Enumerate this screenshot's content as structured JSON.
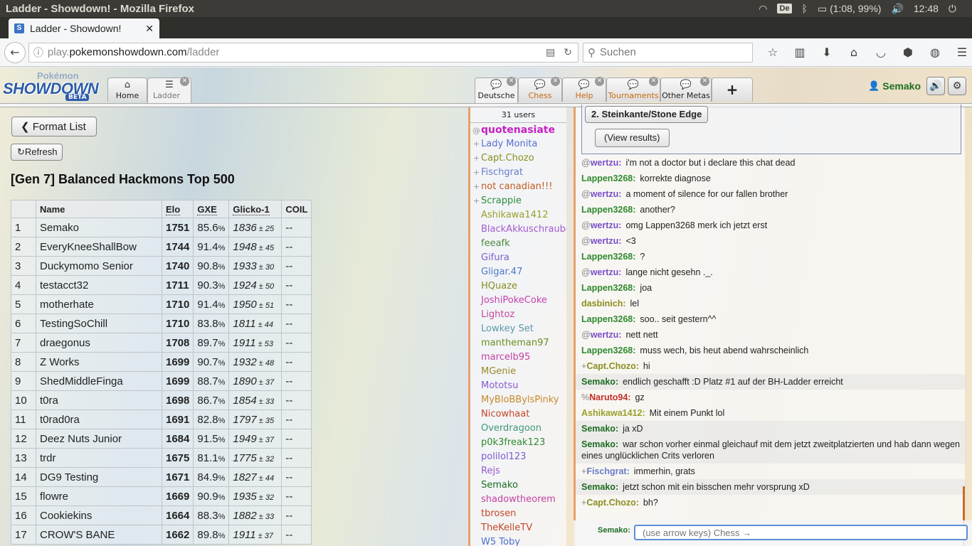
{
  "os": {
    "window_title": "Ladder - Showdown! - Mozilla Firefox",
    "keyboard": "De",
    "battery": "(1:08, 99%)",
    "clock": "12:48"
  },
  "browser": {
    "tab_title": "Ladder - Showdown!",
    "url_prefix": "play.",
    "url_host": "pokemonshowdown.com",
    "url_path": "/ladder",
    "search_placeholder": "Suchen"
  },
  "header": {
    "logo_top": "Pokémon",
    "logo_main": "SHOWDOWN",
    "logo_badge": "BETA",
    "tabs": [
      {
        "label": "Home",
        "icon": "⌂"
      },
      {
        "label": "Ladder",
        "icon": "☰"
      },
      {
        "label": "Deutsche",
        "icon": "💬"
      },
      {
        "label": "Chess",
        "icon": "💬"
      },
      {
        "label": "Help",
        "icon": "💬"
      },
      {
        "label": "Tournaments",
        "icon": "💬"
      },
      {
        "label": "Other Metas",
        "icon": "💬"
      }
    ],
    "add_tab": "+",
    "username": "Semako"
  },
  "ladder": {
    "format_list": "Format List",
    "refresh": "Refresh",
    "title": "[Gen 7] Balanced Hackmons Top 500",
    "columns": [
      "",
      "Name",
      "Elo",
      "GXE",
      "Glicko-1",
      "COIL"
    ],
    "rows": [
      {
        "rank": "1",
        "name": "Semako",
        "elo": "1751",
        "gxe": "85.6",
        "glicko": "1836",
        "dev": "25",
        "coil": "--"
      },
      {
        "rank": "2",
        "name": "EveryKneeShallBow",
        "elo": "1744",
        "gxe": "91.4",
        "glicko": "1948",
        "dev": "45",
        "coil": "--"
      },
      {
        "rank": "3",
        "name": "Duckymomo Senior",
        "elo": "1740",
        "gxe": "90.8",
        "glicko": "1933",
        "dev": "30",
        "coil": "--"
      },
      {
        "rank": "4",
        "name": "testacct32",
        "elo": "1711",
        "gxe": "90.3",
        "glicko": "1924",
        "dev": "50",
        "coil": "--"
      },
      {
        "rank": "5",
        "name": "motherhate",
        "elo": "1710",
        "gxe": "91.4",
        "glicko": "1950",
        "dev": "51",
        "coil": "--"
      },
      {
        "rank": "6",
        "name": "TestingSoChill",
        "elo": "1710",
        "gxe": "83.8",
        "glicko": "1811",
        "dev": "44",
        "coil": "--"
      },
      {
        "rank": "7",
        "name": "draegonus",
        "elo": "1708",
        "gxe": "89.7",
        "glicko": "1911",
        "dev": "53",
        "coil": "--"
      },
      {
        "rank": "8",
        "name": "Z Works",
        "elo": "1699",
        "gxe": "90.7",
        "glicko": "1932",
        "dev": "48",
        "coil": "--"
      },
      {
        "rank": "9",
        "name": "ShedMiddleFinga",
        "elo": "1699",
        "gxe": "88.7",
        "glicko": "1890",
        "dev": "37",
        "coil": "--"
      },
      {
        "rank": "10",
        "name": "t0ra",
        "elo": "1698",
        "gxe": "86.7",
        "glicko": "1854",
        "dev": "33",
        "coil": "--"
      },
      {
        "rank": "11",
        "name": "t0rad0ra",
        "elo": "1691",
        "gxe": "82.8",
        "glicko": "1797",
        "dev": "35",
        "coil": "--"
      },
      {
        "rank": "12",
        "name": "Deez Nuts Junior",
        "elo": "1684",
        "gxe": "91.5",
        "glicko": "1949",
        "dev": "37",
        "coil": "--"
      },
      {
        "rank": "13",
        "name": "trdr",
        "elo": "1675",
        "gxe": "81.1",
        "glicko": "1775",
        "dev": "32",
        "coil": "--"
      },
      {
        "rank": "14",
        "name": "DG9 Testing",
        "elo": "1671",
        "gxe": "84.9",
        "glicko": "1827",
        "dev": "44",
        "coil": "--"
      },
      {
        "rank": "15",
        "name": "flowre",
        "elo": "1669",
        "gxe": "90.9",
        "glicko": "1935",
        "dev": "32",
        "coil": "--"
      },
      {
        "rank": "16",
        "name": "Cookiekins",
        "elo": "1664",
        "gxe": "88.3",
        "glicko": "1882",
        "dev": "33",
        "coil": "--"
      },
      {
        "rank": "17",
        "name": "CROW'S BANE",
        "elo": "1662",
        "gxe": "89.8",
        "glicko": "1911",
        "dev": "37",
        "coil": "--"
      }
    ]
  },
  "userlist": {
    "count": "31 users",
    "users": [
      {
        "rank": "@",
        "name": "quotenasiate",
        "color": "#c71fc4",
        "top": true
      },
      {
        "rank": "+",
        "name": "Lady Monita",
        "color": "#5a6fd0"
      },
      {
        "rank": "+",
        "name": "Capt.Chozo",
        "color": "#8a8f1f"
      },
      {
        "rank": "+",
        "name": "Fischgrat",
        "color": "#6a7ec9"
      },
      {
        "rank": "+",
        "name": "not canadian!!!",
        "color": "#c25b1e"
      },
      {
        "rank": "+",
        "name": "Scrappie",
        "color": "#2f8a3c"
      },
      {
        "rank": " ",
        "name": "Ashikawa1412",
        "color": "#9aa02a"
      },
      {
        "rank": " ",
        "name": "BlackAkkuschrauber",
        "color": "#a45ad2"
      },
      {
        "rank": " ",
        "name": "feeafk",
        "color": "#4f8a3c"
      },
      {
        "rank": " ",
        "name": "Gifura",
        "color": "#7c5fd0"
      },
      {
        "rank": " ",
        "name": "Gligar.47",
        "color": "#4f79c7"
      },
      {
        "rank": " ",
        "name": "HQuaze",
        "color": "#8a8f1f"
      },
      {
        "rank": " ",
        "name": "JoshiPokeCoke",
        "color": "#c73fae"
      },
      {
        "rank": " ",
        "name": "Lightoz",
        "color": "#c4479a"
      },
      {
        "rank": " ",
        "name": "Lowkey Set",
        "color": "#5d9aa8"
      },
      {
        "rank": " ",
        "name": "mantheman97",
        "color": "#6a8f1f"
      },
      {
        "rank": " ",
        "name": "marcelb95",
        "color": "#c440a6"
      },
      {
        "rank": " ",
        "name": "MGenie",
        "color": "#9a8a2a"
      },
      {
        "rank": " ",
        "name": "Mototsu",
        "color": "#8a5ad0"
      },
      {
        "rank": " ",
        "name": "MyBloBBylsPinky",
        "color": "#c88a2a"
      },
      {
        "rank": " ",
        "name": "Nicowhaat",
        "color": "#c4472a"
      },
      {
        "rank": " ",
        "name": "Overdragoon",
        "color": "#3f9a7a"
      },
      {
        "rank": " ",
        "name": "p0k3freak123",
        "color": "#2f8a2f"
      },
      {
        "rank": " ",
        "name": "polilol123",
        "color": "#7a5ad0"
      },
      {
        "rank": " ",
        "name": "Rejs",
        "color": "#9a5ad2"
      },
      {
        "rank": " ",
        "name": "Semako",
        "color": "#1c6c22"
      },
      {
        "rank": " ",
        "name": "shadowtheorem",
        "color": "#c440a6"
      },
      {
        "rank": " ",
        "name": "tbrosen",
        "color": "#c4472a"
      },
      {
        "rank": " ",
        "name": "TheKelleTV",
        "color": "#c4472a"
      },
      {
        "rank": " ",
        "name": "W5 Toby",
        "color": "#4f6fd0"
      }
    ]
  },
  "chat": {
    "poll_option": "2. Steinkante/Stone Edge",
    "view_results": "(View results)",
    "messages": [
      {
        "sym": "@",
        "author": "wertzu:",
        "color": "#7a4fc9",
        "text": "i'm not a doctor but i declare this chat dead"
      },
      {
        "sym": "",
        "author": "Lappen3268:",
        "color": "#2f8a2f",
        "text": "korrekte diagnose"
      },
      {
        "sym": "@",
        "author": "wertzu:",
        "color": "#7a4fc9",
        "text": "a moment of silence for our fallen brother"
      },
      {
        "sym": "",
        "author": "Lappen3268:",
        "color": "#2f8a2f",
        "text": "another?"
      },
      {
        "sym": "@",
        "author": "wertzu:",
        "color": "#7a4fc9",
        "text": "omg Lappen3268 merk ich jetzt erst"
      },
      {
        "sym": "@",
        "author": "wertzu:",
        "color": "#7a4fc9",
        "text": "<3"
      },
      {
        "sym": "",
        "author": "Lappen3268:",
        "color": "#2f8a2f",
        "text": "?"
      },
      {
        "sym": "@",
        "author": "wertzu:",
        "color": "#7a4fc9",
        "text": "lange nicht gesehn ._."
      },
      {
        "sym": "",
        "author": "Lappen3268:",
        "color": "#2f8a2f",
        "text": "joa"
      },
      {
        "sym": "",
        "author": "dasbinich:",
        "color": "#8a8f1f",
        "text": "lel"
      },
      {
        "sym": "",
        "author": "Lappen3268:",
        "color": "#2f8a2f",
        "text": "soo.. seit gestern^^"
      },
      {
        "sym": "@",
        "author": "wertzu:",
        "color": "#7a4fc9",
        "text": "nett nett"
      },
      {
        "sym": "",
        "author": "Lappen3268:",
        "color": "#2f8a2f",
        "text": "muss wech, bis heut abend wahrscheinlich"
      },
      {
        "sym": "+",
        "author": "Capt.Chozo:",
        "color": "#8a8f1f",
        "text": "hi"
      },
      {
        "sym": "",
        "author": "Semako:",
        "color": "#1c6c22",
        "text": "endlich geschafft :D Platz #1 auf der BH-Ladder erreicht",
        "mine": true
      },
      {
        "sym": "%",
        "author": "Naruto94:",
        "color": "#c4302a",
        "text": "gz"
      },
      {
        "sym": "",
        "author": "Ashikawa1412:",
        "color": "#9aa02a",
        "text": "Mit einem Punkt lol"
      },
      {
        "sym": "",
        "author": "Semako:",
        "color": "#1c6c22",
        "text": "ja xD",
        "mine": true
      },
      {
        "sym": "",
        "author": "Semako:",
        "color": "#1c6c22",
        "text": "war schon vorher einmal gleichauf mit dem jetzt zweitplatzierten und hab dann wegen eines unglücklichen Crits verloren",
        "mine": true
      },
      {
        "sym": "+",
        "author": "Fischgrat:",
        "color": "#6a7ec9",
        "text": "immerhin, grats"
      },
      {
        "sym": "",
        "author": "Semako:",
        "color": "#1c6c22",
        "text": "jetzt schon mit ein bisschen mehr vorsprung xD",
        "mine": true
      },
      {
        "sym": "+",
        "author": "Capt.Chozo:",
        "color": "#8a8f1f",
        "text": "bh?"
      }
    ],
    "input_name": "Semako:",
    "input_placeholder": "(use arrow keys) Chess →"
  }
}
